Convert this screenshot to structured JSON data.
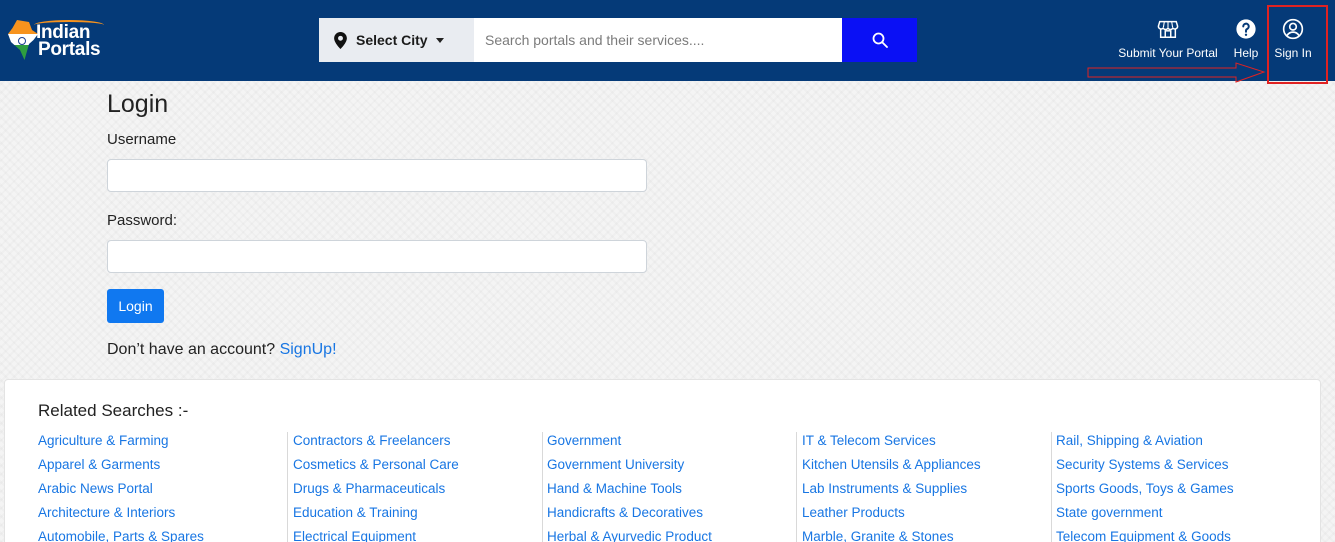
{
  "header": {
    "logo": {
      "line1": "Indian",
      "line2": "Portals"
    },
    "city_select_label": "Select City",
    "search_placeholder": "Search portals and their services....",
    "nav": {
      "submit_portal": "Submit Your Portal",
      "help": "Help",
      "sign_in": "Sign In"
    }
  },
  "login": {
    "title": "Login",
    "username_label": "Username",
    "password_label": "Password:",
    "button_label": "Login",
    "signup_prompt": "Don’t have an account?",
    "signup_link": "SignUp",
    "signup_suffix": "!"
  },
  "related": {
    "title": "Related Searches :-",
    "columns": [
      [
        "Agriculture & Farming",
        "Apparel & Garments",
        "Arabic News Portal",
        "Architecture & Interiors",
        "Automobile, Parts & Spares"
      ],
      [
        "Contractors & Freelancers",
        "Cosmetics & Personal Care",
        "Drugs & Pharmaceuticals",
        "Education & Training",
        "Electrical Equipment"
      ],
      [
        "Government",
        "Government University",
        "Hand & Machine Tools",
        "Handicrafts & Decoratives",
        "Herbal & Ayurvedic Product"
      ],
      [
        "IT & Telecom Services",
        "Kitchen Utensils & Appliances",
        "Lab Instruments & Supplies",
        "Leather Products",
        "Marble, Granite & Stones"
      ],
      [
        "Rail, Shipping & Aviation",
        "Security Systems & Services",
        "Sports Goods, Toys & Games",
        "State government",
        "Telecom Equipment & Goods"
      ]
    ]
  },
  "colors": {
    "header_bg": "#053a78",
    "search_button": "#0a10f5",
    "primary_button": "#1078f0",
    "link": "#1876e3",
    "annotation": "#e02222"
  },
  "icons": [
    "map-pin-icon",
    "search-icon",
    "store-icon",
    "help-icon",
    "user-circle-icon"
  ]
}
